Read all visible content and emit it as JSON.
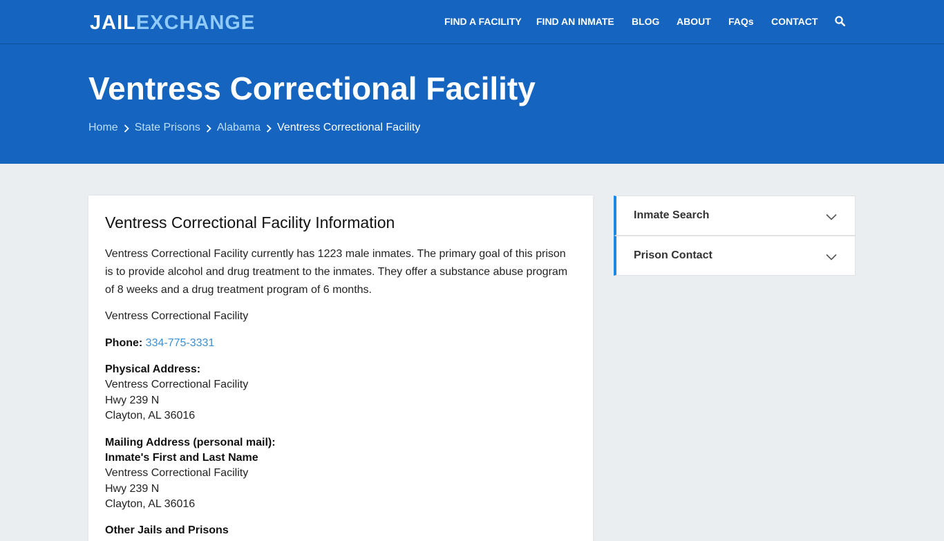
{
  "header": {
    "logo_part_a": "JAIL",
    "logo_part_b": "EXCHANGE",
    "nav": [
      {
        "label": "FIND A FACILITY"
      },
      {
        "label": "FIND AN INMATE"
      },
      {
        "label": "BLOG"
      },
      {
        "label": "ABOUT"
      },
      {
        "label": "FAQs"
      },
      {
        "label": "CONTACT"
      }
    ],
    "search_icon": "search-icon"
  },
  "hero": {
    "title": "Ventress Correctional Facility",
    "breadcrumb": [
      {
        "label": "Home"
      },
      {
        "label": "State Prisons"
      },
      {
        "label": "Alabama"
      },
      {
        "label": "Ventress Correctional Facility"
      }
    ]
  },
  "main": {
    "title": "Ventress Correctional Facility Information",
    "intro": "Ventress Correctional Facility currently has 1223 male inmates. The primary goal of this prison is to provide alcohol and drug treatment to the inmates. They offer a substance abuse program of 8 weeks and a drug treatment program of 6 months.",
    "facility_name": "Ventress Correctional Facility",
    "phone_label": "Phone:",
    "phone": "334-775-3331",
    "physical_label": "Physical Address:",
    "physical_lines": [
      "Ventress Correctional Facility",
      "Hwy 239 N",
      "Clayton, AL 36016"
    ],
    "mailing_label": "Mailing Address (personal mail):",
    "mailing_name": "Inmate's First and Last Name",
    "mailing_lines": [
      "Ventress Correctional Facility",
      "Hwy 239 N",
      "Clayton, AL 36016"
    ],
    "other_label": "Other Jails and Prisons"
  },
  "sidebar": {
    "panels": [
      {
        "label": "Inmate Search"
      },
      {
        "label": "Prison Contact"
      }
    ]
  },
  "colors": {
    "header_bg": "#1565c0",
    "page_bg": "#ebeef1",
    "accent": "#1e88e5",
    "link": "#3b8fd6"
  }
}
